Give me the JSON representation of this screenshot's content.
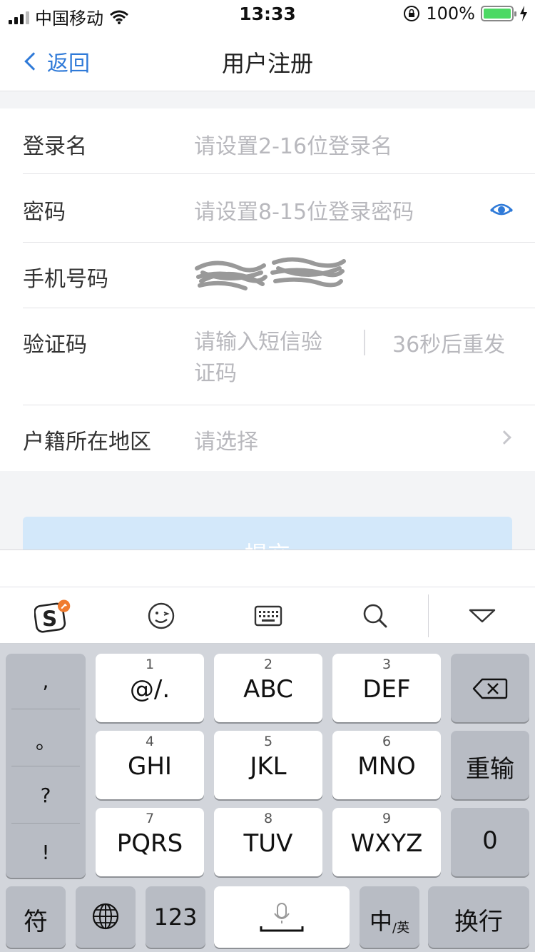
{
  "status_bar": {
    "carrier": "中国移动",
    "time": "13:33",
    "battery": "100%"
  },
  "nav": {
    "back_label": "返回",
    "title": "用户注册"
  },
  "form": {
    "login_name": {
      "label": "登录名",
      "placeholder": "请设置2-16位登录名"
    },
    "password": {
      "label": "密码",
      "placeholder": "请设置8-15位登录密码"
    },
    "phone": {
      "label": "手机号码"
    },
    "sms_code": {
      "label": "验证码",
      "placeholder": "请输入短信验证码",
      "resend": "36秒后重发"
    },
    "region": {
      "label": "户籍所在地区",
      "placeholder": "请选择"
    }
  },
  "submit_label": "提交",
  "keyboard": {
    "punct": [
      ",",
      "。",
      "?",
      "!"
    ],
    "rows": [
      [
        {
          "num": "1",
          "letters": "@/."
        },
        {
          "num": "2",
          "letters": "ABC"
        },
        {
          "num": "3",
          "letters": "DEF"
        }
      ],
      [
        {
          "num": "4",
          "letters": "GHI"
        },
        {
          "num": "5",
          "letters": "JKL"
        },
        {
          "num": "6",
          "letters": "MNO"
        }
      ],
      [
        {
          "num": "7",
          "letters": "PQRS"
        },
        {
          "num": "8",
          "letters": "TUV"
        },
        {
          "num": "9",
          "letters": "WXYZ"
        }
      ]
    ],
    "reinput": "重输",
    "zero": "0",
    "symbols": "符",
    "numbers": "123",
    "lang_main": "中",
    "lang_sub": "/英",
    "enter": "换行"
  },
  "colors": {
    "accent": "#2f7ad8",
    "submit_bg": "#d3e8fa",
    "battery_fill": "#4cd964"
  }
}
